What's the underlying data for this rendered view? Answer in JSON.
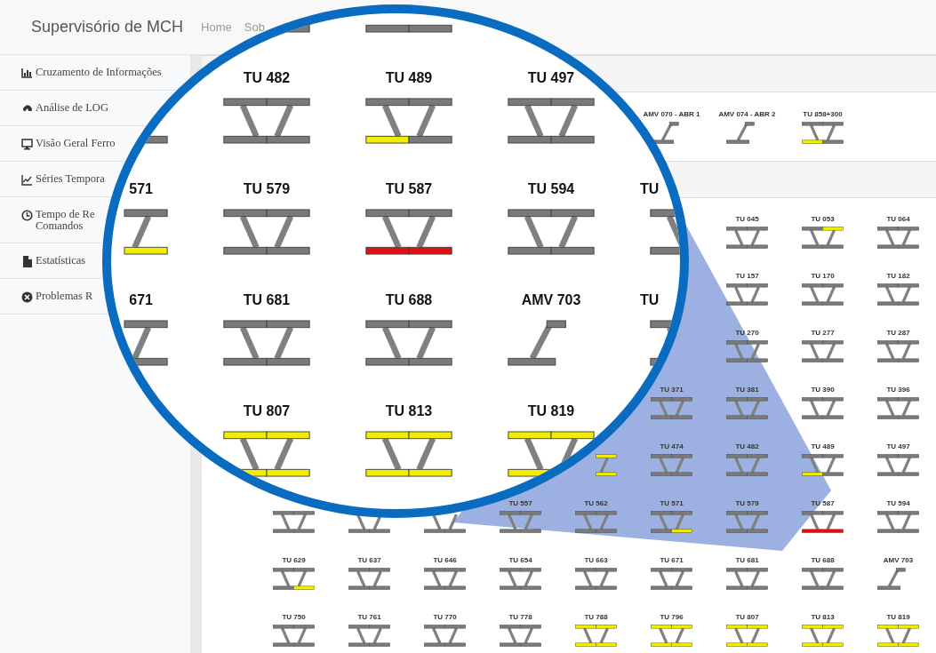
{
  "navbar": {
    "title": "Supervisório de MCH",
    "links": [
      "Home",
      "Sob"
    ]
  },
  "sidebar": {
    "items": [
      {
        "lines": [
          "Cruzamento de Informações"
        ]
      },
      {
        "lines": [
          "Análise de LOG"
        ]
      },
      {
        "lines": [
          "Visão Geral Ferro"
        ]
      },
      {
        "lines": [
          "Séries Tempora"
        ]
      },
      {
        "lines": [
          "Tempo de Re",
          "Comandos"
        ]
      },
      {
        "lines": [
          "Estatísticas"
        ]
      },
      {
        "lines": [
          "Problemas R"
        ]
      }
    ]
  },
  "section_1": {
    "cells": [
      {
        "kind": "empty"
      },
      {
        "kind": "empty"
      },
      {
        "kind": "empty"
      },
      {
        "kind": "empty"
      },
      {
        "kind": "empty"
      },
      {
        "kind": "switch",
        "label": "AMV 070 - ABR 1"
      },
      {
        "kind": "switch",
        "label": "AMV 074 - ABR 2"
      },
      {
        "kind": "crossover",
        "label": "TU 858+300",
        "segments": [
          {
            "color": "#7a7a7a"
          },
          {
            "color": "#7a7a7a"
          },
          {
            "color": "#f2ee00"
          },
          {
            "color": "#7a7a7a"
          }
        ]
      }
    ]
  },
  "section_2": {
    "rows": [
      [
        {
          "kind": "empty"
        },
        {
          "kind": "empty"
        },
        {
          "kind": "empty"
        },
        {
          "kind": "empty"
        },
        {
          "kind": "empty"
        },
        {
          "kind": "empty"
        },
        {
          "kind": "crossover",
          "label": "TU 045",
          "segments": [
            {
              "color": "#7a7a7a"
            },
            {
              "color": "#7a7a7a"
            },
            {
              "color": "#7a7a7a"
            },
            {
              "color": "#7a7a7a"
            }
          ]
        },
        {
          "kind": "crossover",
          "label": "TU 053",
          "segments": [
            {
              "color": "#7a7a7a"
            },
            {
              "color": "#f2ee00"
            },
            {
              "color": "#7a7a7a"
            },
            {
              "color": "#7a7a7a"
            }
          ]
        },
        {
          "kind": "crossover",
          "label": "TU 064",
          "segments": [
            {
              "color": "#7a7a7a"
            },
            {
              "color": "#7a7a7a"
            },
            {
              "color": "#7a7a7a"
            },
            {
              "color": "#7a7a7a"
            }
          ]
        }
      ],
      [
        {
          "kind": "empty"
        },
        {
          "kind": "empty"
        },
        {
          "kind": "empty"
        },
        {
          "kind": "empty"
        },
        {
          "kind": "empty"
        },
        {
          "kind": "empty"
        },
        {
          "kind": "crossover",
          "label": "TU 157",
          "segments": [
            {
              "color": "#7a7a7a"
            },
            {
              "color": "#7a7a7a"
            },
            {
              "color": "#7a7a7a"
            },
            {
              "color": "#7a7a7a"
            }
          ]
        },
        {
          "kind": "crossover",
          "label": "TU 170",
          "segments": [
            {
              "color": "#7a7a7a"
            },
            {
              "color": "#7a7a7a"
            },
            {
              "color": "#7a7a7a"
            },
            {
              "color": "#7a7a7a"
            }
          ]
        },
        {
          "kind": "crossover",
          "label": "TU 182",
          "segments": [
            {
              "color": "#7a7a7a"
            },
            {
              "color": "#7a7a7a"
            },
            {
              "color": "#7a7a7a"
            },
            {
              "color": "#7a7a7a"
            }
          ]
        }
      ],
      [
        {
          "kind": "empty"
        },
        {
          "kind": "empty"
        },
        {
          "kind": "empty"
        },
        {
          "kind": "empty"
        },
        {
          "kind": "empty"
        },
        {
          "kind": "empty"
        },
        {
          "kind": "crossover",
          "label": "TU 270",
          "segments": [
            {
              "color": "#7a7a7a"
            },
            {
              "color": "#7a7a7a"
            },
            {
              "color": "#7a7a7a"
            },
            {
              "color": "#7a7a7a"
            }
          ]
        },
        {
          "kind": "crossover",
          "label": "TU 277",
          "segments": [
            {
              "color": "#7a7a7a"
            },
            {
              "color": "#7a7a7a"
            },
            {
              "color": "#7a7a7a"
            },
            {
              "color": "#7a7a7a"
            }
          ]
        },
        {
          "kind": "crossover",
          "label": "TU 287",
          "segments": [
            {
              "color": "#7a7a7a"
            },
            {
              "color": "#7a7a7a"
            },
            {
              "color": "#7a7a7a"
            },
            {
              "color": "#7a7a7a"
            }
          ]
        }
      ],
      [
        {
          "kind": "empty"
        },
        {
          "kind": "empty"
        },
        {
          "kind": "empty"
        },
        {
          "kind": "empty"
        },
        {
          "kind": "empty"
        },
        {
          "kind": "crossover",
          "label": "TU 371",
          "segments": [
            {
              "color": "#7a7a7a"
            },
            {
              "color": "#7a7a7a"
            },
            {
              "color": "#7a7a7a"
            },
            {
              "color": "#7a7a7a"
            }
          ]
        },
        {
          "kind": "crossover",
          "label": "TU 381",
          "segments": [
            {
              "color": "#7a7a7a"
            },
            {
              "color": "#7a7a7a"
            },
            {
              "color": "#7a7a7a"
            },
            {
              "color": "#7a7a7a"
            }
          ]
        },
        {
          "kind": "crossover",
          "label": "TU 390",
          "segments": [
            {
              "color": "#7a7a7a"
            },
            {
              "color": "#7a7a7a"
            },
            {
              "color": "#7a7a7a"
            },
            {
              "color": "#7a7a7a"
            }
          ]
        },
        {
          "kind": "crossover",
          "label": "TU 396",
          "segments": [
            {
              "color": "#7a7a7a"
            },
            {
              "color": "#7a7a7a"
            },
            {
              "color": "#7a7a7a"
            },
            {
              "color": "#7a7a7a"
            }
          ]
        }
      ],
      [
        {
          "kind": "empty"
        },
        {
          "kind": "empty"
        },
        {
          "kind": "empty"
        },
        {
          "kind": "empty"
        },
        {
          "kind": "crossover-right",
          "segments": [
            {
              "color": "#f2ee00"
            },
            {
              "color": "#f2ee00"
            }
          ]
        },
        {
          "kind": "crossover",
          "label": "TU 474",
          "segments": [
            {
              "color": "#7a7a7a"
            },
            {
              "color": "#7a7a7a"
            },
            {
              "color": "#7a7a7a"
            },
            {
              "color": "#7a7a7a"
            }
          ]
        },
        {
          "kind": "crossover",
          "label": "TU 482",
          "segments": [
            {
              "color": "#7a7a7a"
            },
            {
              "color": "#7a7a7a"
            },
            {
              "color": "#7a7a7a"
            },
            {
              "color": "#7a7a7a"
            }
          ]
        },
        {
          "kind": "crossover",
          "label": "TU 489",
          "segments": [
            {
              "color": "#7a7a7a"
            },
            {
              "color": "#7a7a7a"
            },
            {
              "color": "#f2ee00"
            },
            {
              "color": "#7a7a7a"
            }
          ]
        },
        {
          "kind": "crossover",
          "label": "TU 497",
          "segments": [
            {
              "color": "#7a7a7a"
            },
            {
              "color": "#7a7a7a"
            },
            {
              "color": "#7a7a7a"
            },
            {
              "color": "#7a7a7a"
            }
          ]
        }
      ],
      [
        {
          "kind": "crossover",
          "segments": [
            {
              "color": "#7a7a7a"
            },
            {
              "color": "#7a7a7a"
            },
            {
              "color": "#7a7a7a"
            },
            {
              "color": "#7a7a7a"
            }
          ]
        },
        {
          "kind": "crossover-bottom",
          "segments": [
            {
              "color": "#7a7a7a"
            },
            {
              "color": "#7a7a7a"
            }
          ]
        },
        {
          "kind": "crossover-bottom",
          "segments": [
            {
              "color": "#7a7a7a"
            },
            {
              "color": "#7a7a7a"
            }
          ]
        },
        {
          "kind": "crossover",
          "label": "TU 557",
          "segments": [
            {
              "color": "#7a7a7a"
            },
            {
              "color": "#7a7a7a"
            },
            {
              "color": "#7a7a7a"
            },
            {
              "color": "#7a7a7a"
            }
          ]
        },
        {
          "kind": "crossover",
          "label": "TU 562",
          "segments": [
            {
              "color": "#7a7a7a"
            },
            {
              "color": "#7a7a7a"
            },
            {
              "color": "#7a7a7a"
            },
            {
              "color": "#7a7a7a"
            }
          ]
        },
        {
          "kind": "crossover",
          "label": "TU 571",
          "segments": [
            {
              "color": "#7a7a7a"
            },
            {
              "color": "#7a7a7a"
            },
            {
              "color": "#7a7a7a"
            },
            {
              "color": "#f2ee00"
            }
          ]
        },
        {
          "kind": "crossover",
          "label": "TU 579",
          "segments": [
            {
              "color": "#7a7a7a"
            },
            {
              "color": "#7a7a7a"
            },
            {
              "color": "#7a7a7a"
            },
            {
              "color": "#7a7a7a"
            }
          ]
        },
        {
          "kind": "crossover",
          "label": "TU 587",
          "segments": [
            {
              "color": "#7a7a7a"
            },
            {
              "color": "#7a7a7a"
            },
            {
              "color": "#e01010"
            },
            {
              "color": "#e01010"
            }
          ]
        },
        {
          "kind": "crossover",
          "label": "TU 594",
          "segments": [
            {
              "color": "#7a7a7a"
            },
            {
              "color": "#7a7a7a"
            },
            {
              "color": "#7a7a7a"
            },
            {
              "color": "#7a7a7a"
            }
          ]
        }
      ],
      [
        {
          "kind": "crossover",
          "label": "TU 629",
          "segments": [
            {
              "color": "#7a7a7a"
            },
            {
              "color": "#7a7a7a"
            },
            {
              "color": "#7a7a7a"
            },
            {
              "color": "#f2ee00"
            }
          ]
        },
        {
          "kind": "crossover",
          "label": "TU 637",
          "segments": [
            {
              "color": "#7a7a7a"
            },
            {
              "color": "#7a7a7a"
            },
            {
              "color": "#7a7a7a"
            },
            {
              "color": "#7a7a7a"
            }
          ]
        },
        {
          "kind": "crossover",
          "label": "TU 646",
          "segments": [
            {
              "color": "#7a7a7a"
            },
            {
              "color": "#7a7a7a"
            },
            {
              "color": "#7a7a7a"
            },
            {
              "color": "#7a7a7a"
            }
          ]
        },
        {
          "kind": "crossover",
          "label": "TU 654",
          "segments": [
            {
              "color": "#7a7a7a"
            },
            {
              "color": "#7a7a7a"
            },
            {
              "color": "#7a7a7a"
            },
            {
              "color": "#7a7a7a"
            }
          ]
        },
        {
          "kind": "crossover",
          "label": "TU 663",
          "segments": [
            {
              "color": "#7a7a7a"
            },
            {
              "color": "#7a7a7a"
            },
            {
              "color": "#7a7a7a"
            },
            {
              "color": "#7a7a7a"
            }
          ]
        },
        {
          "kind": "crossover",
          "label": "TU 671",
          "segments": [
            {
              "color": "#7a7a7a"
            },
            {
              "color": "#7a7a7a"
            },
            {
              "color": "#7a7a7a"
            },
            {
              "color": "#7a7a7a"
            }
          ]
        },
        {
          "kind": "crossover",
          "label": "TU 681",
          "segments": [
            {
              "color": "#7a7a7a"
            },
            {
              "color": "#7a7a7a"
            },
            {
              "color": "#7a7a7a"
            },
            {
              "color": "#7a7a7a"
            }
          ]
        },
        {
          "kind": "crossover",
          "label": "TU 688",
          "segments": [
            {
              "color": "#7a7a7a"
            },
            {
              "color": "#7a7a7a"
            },
            {
              "color": "#7a7a7a"
            },
            {
              "color": "#7a7a7a"
            }
          ]
        },
        {
          "kind": "switch",
          "label": "AMV 703"
        }
      ],
      [
        {
          "kind": "crossover",
          "label": "TU 750",
          "segments": [
            {
              "color": "#7a7a7a"
            },
            {
              "color": "#7a7a7a"
            },
            {
              "color": "#7a7a7a"
            },
            {
              "color": "#7a7a7a"
            }
          ]
        },
        {
          "kind": "crossover",
          "label": "TU 761",
          "segments": [
            {
              "color": "#7a7a7a"
            },
            {
              "color": "#7a7a7a"
            },
            {
              "color": "#7a7a7a"
            },
            {
              "color": "#7a7a7a"
            }
          ]
        },
        {
          "kind": "crossover",
          "label": "TU 770",
          "segments": [
            {
              "color": "#7a7a7a"
            },
            {
              "color": "#7a7a7a"
            },
            {
              "color": "#7a7a7a"
            },
            {
              "color": "#7a7a7a"
            }
          ]
        },
        {
          "kind": "crossover",
          "label": "TU 778",
          "segments": [
            {
              "color": "#7a7a7a"
            },
            {
              "color": "#7a7a7a"
            },
            {
              "color": "#7a7a7a"
            },
            {
              "color": "#7a7a7a"
            }
          ]
        },
        {
          "kind": "crossover",
          "label": "TU 788",
          "segments": [
            {
              "color": "#f2ee00"
            },
            {
              "color": "#f2ee00"
            },
            {
              "color": "#f2ee00"
            },
            {
              "color": "#f2ee00"
            }
          ]
        },
        {
          "kind": "crossover",
          "label": "TU 796",
          "segments": [
            {
              "color": "#f2ee00"
            },
            {
              "color": "#f2ee00"
            },
            {
              "color": "#f2ee00"
            },
            {
              "color": "#f2ee00"
            }
          ]
        },
        {
          "kind": "crossover",
          "label": "TU 807",
          "segments": [
            {
              "color": "#f2ee00"
            },
            {
              "color": "#f2ee00"
            },
            {
              "color": "#f2ee00"
            },
            {
              "color": "#f2ee00"
            }
          ]
        },
        {
          "kind": "crossover",
          "label": "TU 813",
          "segments": [
            {
              "color": "#f2ee00"
            },
            {
              "color": "#f2ee00"
            },
            {
              "color": "#f2ee00"
            },
            {
              "color": "#f2ee00"
            }
          ]
        },
        {
          "kind": "crossover",
          "label": "TU 819",
          "segments": [
            {
              "color": "#f2ee00"
            },
            {
              "color": "#f2ee00"
            },
            {
              "color": "#f2ee00"
            },
            {
              "color": "#f2ee00"
            }
          ]
        }
      ]
    ]
  },
  "magnifier": {
    "rows": [
      [
        {
          "kind": "empty"
        },
        {
          "kind": "bar-right",
          "segments": [
            {
              "color": "#7a7a7a"
            }
          ]
        },
        {
          "kind": "bars",
          "segments": [
            {
              "color": "#7a7a7a"
            },
            {
              "color": "#7a7a7a"
            }
          ]
        },
        {
          "kind": "empty"
        },
        {
          "kind": "empty"
        }
      ],
      [
        {
          "kind": "bar-right",
          "segments": [
            {
              "color": "#7a7a7a"
            }
          ]
        },
        {
          "kind": "crossover",
          "label": "TU 482",
          "segments": [
            {
              "color": "#7a7a7a"
            },
            {
              "color": "#7a7a7a"
            },
            {
              "color": "#7a7a7a"
            },
            {
              "color": "#7a7a7a"
            }
          ]
        },
        {
          "kind": "crossover",
          "label": "TU 489",
          "segments": [
            {
              "color": "#7a7a7a"
            },
            {
              "color": "#7a7a7a"
            },
            {
              "color": "#f2ee00"
            },
            {
              "color": "#7a7a7a"
            }
          ]
        },
        {
          "kind": "crossover",
          "label": "TU 497",
          "segments": [
            {
              "color": "#7a7a7a"
            },
            {
              "color": "#7a7a7a"
            },
            {
              "color": "#7a7a7a"
            },
            {
              "color": "#7a7a7a"
            }
          ]
        },
        {
          "kind": "empty"
        }
      ],
      [
        {
          "kind": "crossover-right",
          "label": "571",
          "segments": [
            {
              "color": "#7a7a7a"
            },
            {
              "color": "#f2ee00"
            }
          ]
        },
        {
          "kind": "crossover",
          "label": "TU 579",
          "segments": [
            {
              "color": "#7a7a7a"
            },
            {
              "color": "#7a7a7a"
            },
            {
              "color": "#7a7a7a"
            },
            {
              "color": "#7a7a7a"
            }
          ]
        },
        {
          "kind": "crossover",
          "label": "TU 587",
          "segments": [
            {
              "color": "#7a7a7a"
            },
            {
              "color": "#7a7a7a"
            },
            {
              "color": "#e01010"
            },
            {
              "color": "#e01010"
            }
          ]
        },
        {
          "kind": "crossover",
          "label": "TU 594",
          "segments": [
            {
              "color": "#7a7a7a"
            },
            {
              "color": "#7a7a7a"
            },
            {
              "color": "#7a7a7a"
            },
            {
              "color": "#7a7a7a"
            }
          ]
        },
        {
          "kind": "crossover-left",
          "label": "TU",
          "segments": [
            {
              "color": "#7a7a7a"
            },
            {
              "color": "#7a7a7a"
            }
          ]
        }
      ],
      [
        {
          "kind": "crossover-right",
          "label": "671",
          "segments": [
            {
              "color": "#7a7a7a"
            },
            {
              "color": "#7a7a7a"
            }
          ]
        },
        {
          "kind": "crossover",
          "label": "TU 681",
          "segments": [
            {
              "color": "#7a7a7a"
            },
            {
              "color": "#7a7a7a"
            },
            {
              "color": "#7a7a7a"
            },
            {
              "color": "#7a7a7a"
            }
          ]
        },
        {
          "kind": "crossover",
          "label": "TU 688",
          "segments": [
            {
              "color": "#7a7a7a"
            },
            {
              "color": "#7a7a7a"
            },
            {
              "color": "#7a7a7a"
            },
            {
              "color": "#7a7a7a"
            }
          ]
        },
        {
          "kind": "switch",
          "label": "AMV 703"
        },
        {
          "kind": "crossover-left",
          "label": "TU",
          "segments": [
            {
              "color": "#7a7a7a"
            },
            {
              "color": "#7a7a7a"
            }
          ]
        }
      ],
      [
        {
          "kind": "empty"
        },
        {
          "kind": "crossover",
          "label": "TU 807",
          "segments": [
            {
              "color": "#f2ee00"
            },
            {
              "color": "#f2ee00"
            },
            {
              "color": "#f2ee00"
            },
            {
              "color": "#f2ee00"
            }
          ]
        },
        {
          "kind": "crossover",
          "label": "TU 813",
          "segments": [
            {
              "color": "#f2ee00"
            },
            {
              "color": "#f2ee00"
            },
            {
              "color": "#f2ee00"
            },
            {
              "color": "#f2ee00"
            }
          ]
        },
        {
          "kind": "crossover-3",
          "label": "TU 819",
          "segments": [
            {
              "color": "#f2ee00"
            },
            {
              "color": "#f2ee00"
            },
            {
              "color": "#f2ee00"
            }
          ]
        },
        {
          "kind": "empty"
        }
      ]
    ]
  }
}
